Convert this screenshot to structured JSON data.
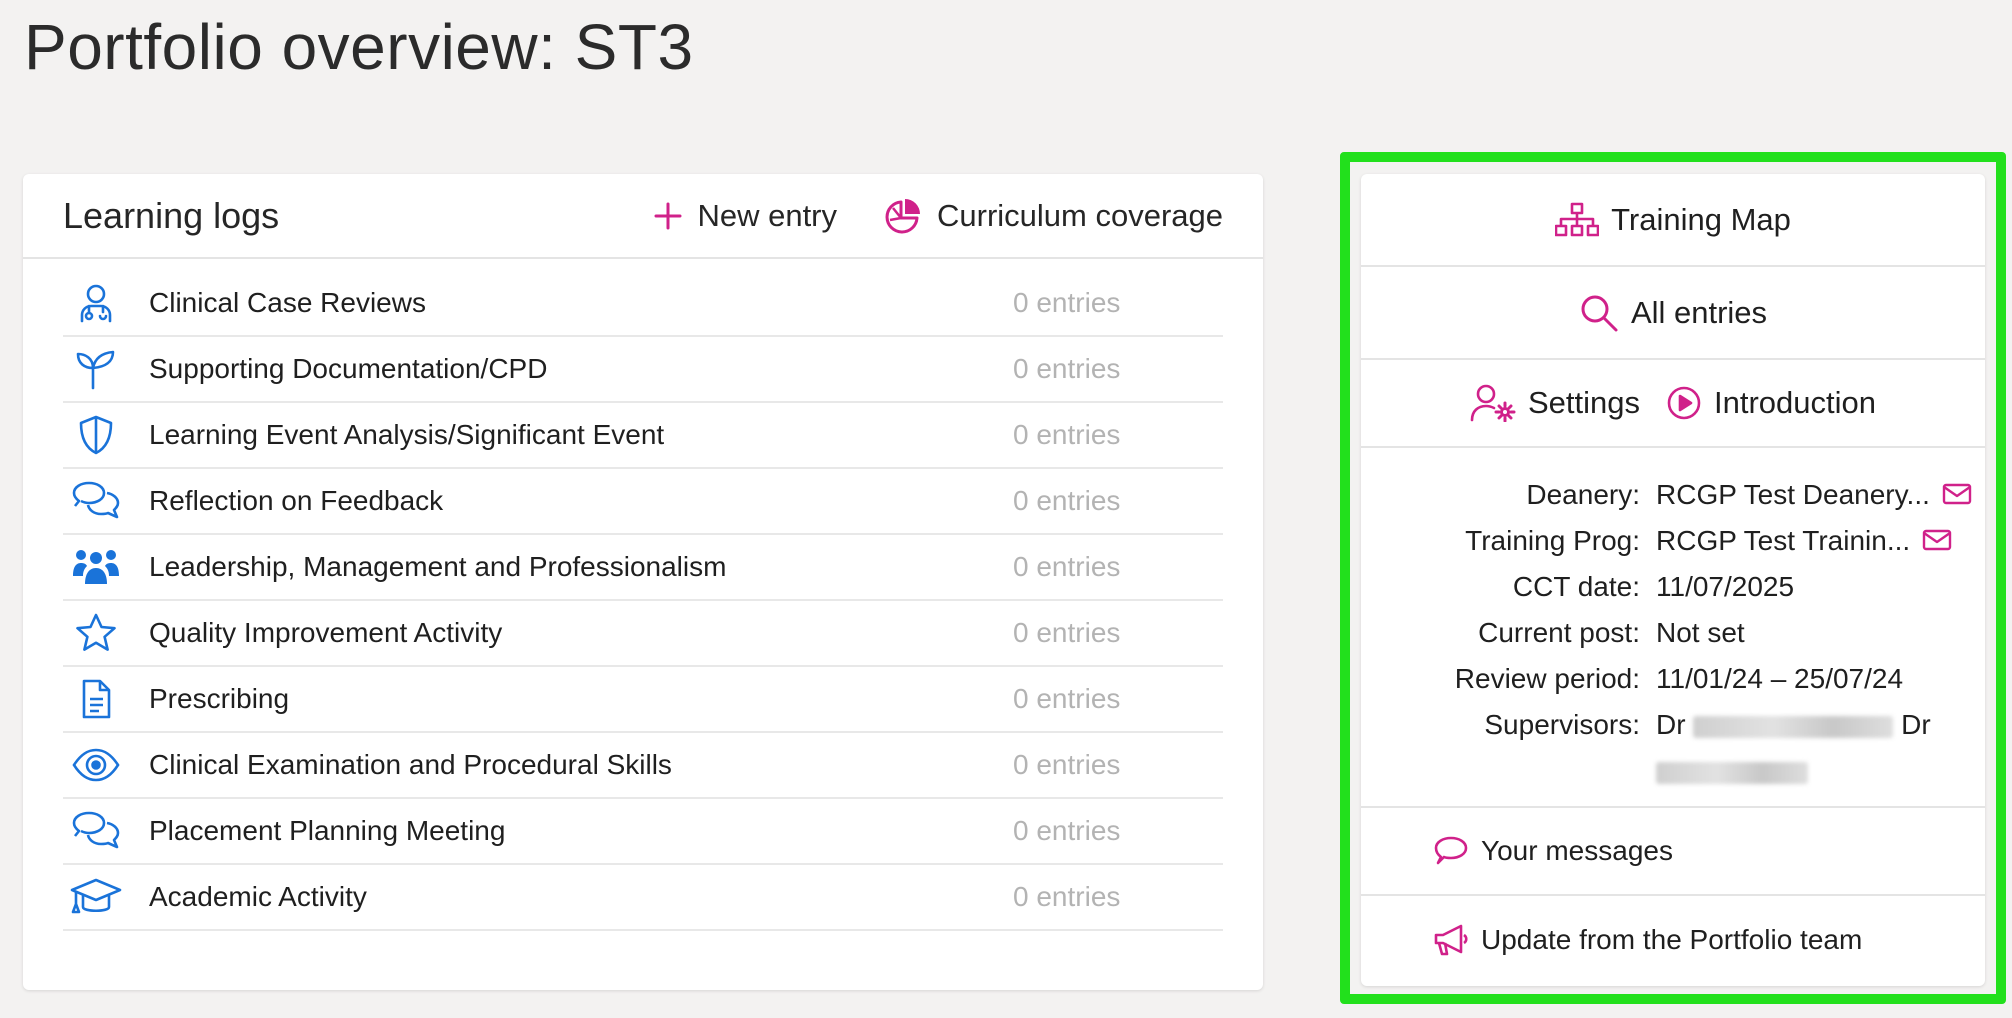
{
  "page": {
    "title": "Portfolio overview: ST3"
  },
  "logs": {
    "title": "Learning logs",
    "new_entry_label": "New entry",
    "curriculum_label": "Curriculum coverage",
    "items": [
      {
        "label": "Clinical Case Reviews",
        "count": "0 entries",
        "icon": "doctor-icon"
      },
      {
        "label": "Supporting Documentation/CPD",
        "count": "0 entries",
        "icon": "seedling-icon"
      },
      {
        "label": "Learning Event Analysis/Significant Event",
        "count": "0 entries",
        "icon": "shield-icon"
      },
      {
        "label": "Reflection on Feedback",
        "count": "0 entries",
        "icon": "chat-bubbles-icon"
      },
      {
        "label": "Leadership, Management and Professionalism",
        "count": "0 entries",
        "icon": "people-group-icon"
      },
      {
        "label": "Quality Improvement Activity",
        "count": "0 entries",
        "icon": "star-icon"
      },
      {
        "label": "Prescribing",
        "count": "0 entries",
        "icon": "document-icon"
      },
      {
        "label": "Clinical Examination and Procedural Skills",
        "count": "0 entries",
        "icon": "eye-icon"
      },
      {
        "label": "Placement Planning Meeting",
        "count": "0 entries",
        "icon": "chat-bubbles-icon"
      },
      {
        "label": "Academic Activity",
        "count": "0 entries",
        "icon": "graduation-cap-icon"
      }
    ]
  },
  "side": {
    "training_map_label": "Training Map",
    "all_entries_label": "All entries",
    "settings_label": "Settings",
    "introduction_label": "Introduction",
    "info": {
      "deanery_key": "Deanery:",
      "deanery_val": "RCGP Test Deanery...",
      "prog_key": "Training Prog:",
      "prog_val": "RCGP Test Trainin...",
      "cct_key": "CCT date:",
      "cct_val": "11/07/2025",
      "post_key": "Current post:",
      "post_val": "Not set",
      "review_key": "Review period:",
      "review_val": "11/01/24 – 25/07/24",
      "sup_key": "Supervisors:",
      "sup_prefix_1": "Dr",
      "sup_prefix_2": "Dr"
    },
    "messages_label": "Your messages",
    "update_label": "Update from the Portfolio team"
  },
  "colors": {
    "accent": "#d0218a",
    "icon_blue": "#1a73d9",
    "highlight": "#22e01c",
    "muted": "#b3b3b3"
  }
}
